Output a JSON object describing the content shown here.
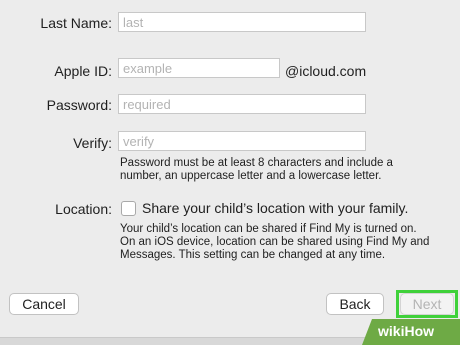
{
  "form": {
    "last_name": {
      "label": "Last Name:",
      "placeholder": "last"
    },
    "apple_id": {
      "label": "Apple ID:",
      "placeholder": "example",
      "suffix": "@icloud.com"
    },
    "password": {
      "label": "Password:",
      "placeholder": "required"
    },
    "verify": {
      "label": "Verify:",
      "placeholder": "verify"
    },
    "password_hint_lines": [
      "Password must be at least 8 characters and include a",
      "number, an uppercase letter and a lowercase letter."
    ],
    "location": {
      "label": "Location:",
      "checkbox_label": "Share your child’s location with your family.",
      "checked": false
    },
    "location_note_lines": [
      "Your child’s location can be shared if Find My is turned on.",
      "On an iOS device, location can be shared using Find My and",
      "Messages. This setting can be changed at any time."
    ]
  },
  "buttons": {
    "cancel": "Cancel",
    "back": "Back",
    "next": "Next"
  },
  "watermark": {
    "text": "wikiHow"
  },
  "colors": {
    "highlight": "#3fd13a",
    "watermark_bg": "#6eaa45",
    "placeholder": "#b3b3b3",
    "disabled_text": "#b4b4b4"
  }
}
